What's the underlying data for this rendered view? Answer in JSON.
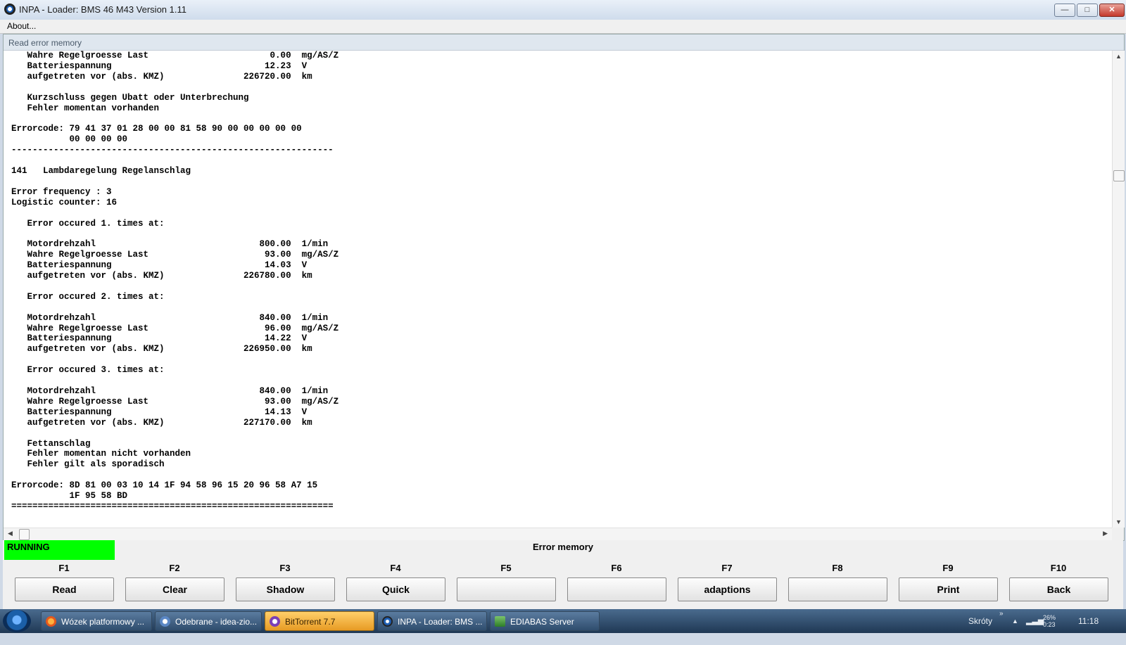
{
  "window": {
    "title": "INPA - Loader:  BMS 46 M43 Version 1.11",
    "min_label": "—",
    "max_label": "□",
    "close_label": "✕"
  },
  "menu": {
    "about": "About..."
  },
  "pane": {
    "header": "Read error memory",
    "content": "   Wahre Regelgroesse Last                       0.00  mg/AS/Z\n   Batteriespannung                             12.23  V\n   aufgetreten vor (abs. KMZ)               226720.00  km\n\n   Kurzschluss gegen Ubatt oder Unterbrechung\n   Fehler momentan vorhanden\n\nErrorcode: 79 41 37 01 28 00 00 81 58 90 00 00 00 00 00\n           00 00 00 00\n-------------------------------------------------------------\n\n141   Lambdaregelung Regelanschlag\n\nError frequency : 3\nLogistic counter: 16\n\n   Error occured 1. times at:\n\n   Motordrehzahl                               800.00  1/min\n   Wahre Regelgroesse Last                      93.00  mg/AS/Z\n   Batteriespannung                             14.03  V\n   aufgetreten vor (abs. KMZ)               226780.00  km\n\n   Error occured 2. times at:\n\n   Motordrehzahl                               840.00  1/min\n   Wahre Regelgroesse Last                      96.00  mg/AS/Z\n   Batteriespannung                             14.22  V\n   aufgetreten vor (abs. KMZ)               226950.00  km\n\n   Error occured 3. times at:\n\n   Motordrehzahl                               840.00  1/min\n   Wahre Regelgroesse Last                      93.00  mg/AS/Z\n   Batteriespannung                             14.13  V\n   aufgetreten vor (abs. KMZ)               227170.00  km\n\n   Fettanschlag\n   Fehler momentan nicht vorhanden\n   Fehler gilt als sporadisch\n\nErrorcode: 8D 81 00 03 10 14 1F 94 58 96 15 20 96 58 A7 15\n           1F 95 58 BD\n============================================================="
  },
  "status": {
    "running": "RUNNING",
    "title": "Error memory",
    "running_color": "#00ff00"
  },
  "fkeys": [
    {
      "key": "F1",
      "label": "Read"
    },
    {
      "key": "F2",
      "label": "Clear"
    },
    {
      "key": "F3",
      "label": "Shadow"
    },
    {
      "key": "F4",
      "label": "Quick"
    },
    {
      "key": "F5",
      "label": ""
    },
    {
      "key": "F6",
      "label": ""
    },
    {
      "key": "F7",
      "label": "adaptions"
    },
    {
      "key": "F8",
      "label": ""
    },
    {
      "key": "F9",
      "label": "Print"
    },
    {
      "key": "F10",
      "label": "Back"
    }
  ],
  "taskbar": {
    "tasks": [
      {
        "label": "Wózek platformowy ...",
        "icon": "firefox-icon"
      },
      {
        "label": "Odebrane - idea-zio...",
        "icon": "mail-icon"
      },
      {
        "label": "BitTorrent 7.7",
        "icon": "bittorrent-icon"
      },
      {
        "label": "INPA - Loader:  BMS ...",
        "icon": "bmw-icon"
      },
      {
        "label": "EDIABAS Server",
        "icon": "server-icon"
      }
    ],
    "shortcuts": "Skróty",
    "battery": "26%",
    "battery_time": "0:23",
    "clock": "11:18"
  }
}
